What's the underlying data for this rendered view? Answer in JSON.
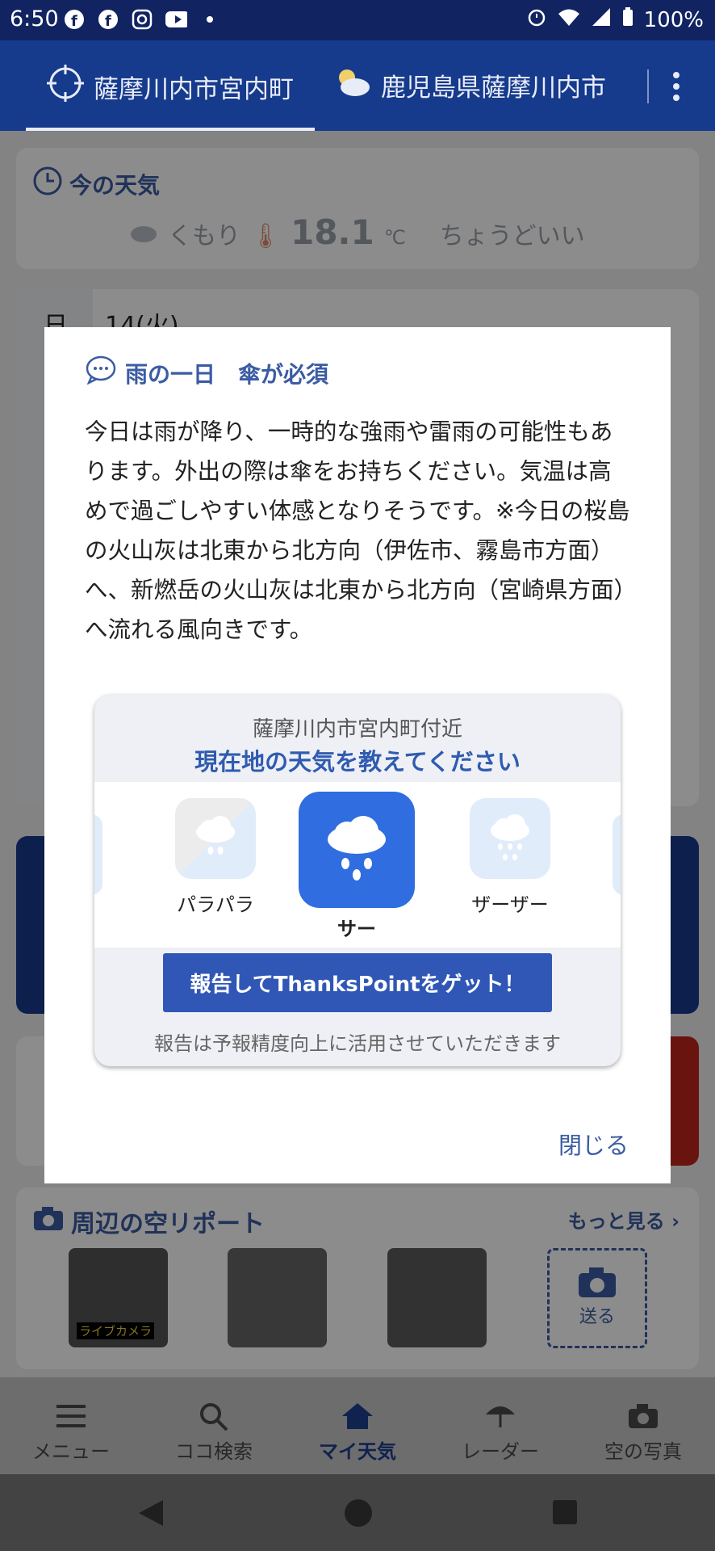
{
  "status_bar": {
    "time": "6:50",
    "battery": "100%"
  },
  "header": {
    "tabs": [
      {
        "label": "薩摩川内市宮内町",
        "icon": "location-target-icon"
      },
      {
        "label": "鹿児島県薩摩川内市",
        "icon": "cloud-sun-icon"
      }
    ]
  },
  "background": {
    "current_weather": {
      "title": "今の天気",
      "condition": "くもり",
      "temperature": "18.1",
      "temp_unit": "℃",
      "feel": "ちょうどいい"
    },
    "forecast": {
      "row_label": "日",
      "date": "14(火)"
    },
    "sky_report": {
      "title": "周辺の空リポート",
      "more": "もっと見る",
      "live_label": "ライブカメラ",
      "send": "送る"
    }
  },
  "dialog": {
    "title": "雨の一日　傘が必須",
    "body": "今日は雨が降り、一時的な強雨や雷雨の可能性もあります。外出の際は傘をお持ちください。気温は高めで過ごしやすい体感となりそうです。※今日の桜島の火山灰は北東から北方向（伊佐市、霧島市方面）へ、新燃岳の火山灰は北東から北方向（宮崎県方面）へ流れる風向きです。",
    "report": {
      "location": "薩摩川内市宮内町付近",
      "ask": "現在地の天気を教えてください",
      "choices": [
        {
          "label": "パラパラ",
          "icon": "light-rain-icon",
          "selected": false
        },
        {
          "label": "サー",
          "icon": "rain-icon",
          "selected": true
        },
        {
          "label": "ザーザー",
          "icon": "heavy-rain-icon",
          "selected": false
        }
      ],
      "button": "報告してThanksPointをゲット！",
      "note": "報告は予報精度向上に活用させていただきます"
    },
    "close": "閉じる"
  },
  "bottom_nav": {
    "items": [
      {
        "label": "メニュー",
        "icon": "menu-icon"
      },
      {
        "label": "ココ検索",
        "icon": "search-icon"
      },
      {
        "label": "マイ天気",
        "icon": "home-icon"
      },
      {
        "label": "レーダー",
        "icon": "umbrella-icon"
      },
      {
        "label": "空の写真",
        "icon": "camera-icon"
      }
    ],
    "active": "マイ天気"
  },
  "colors": {
    "header": "#163a8c",
    "accent": "#3057b6",
    "selected_tile": "#2f6de0"
  }
}
